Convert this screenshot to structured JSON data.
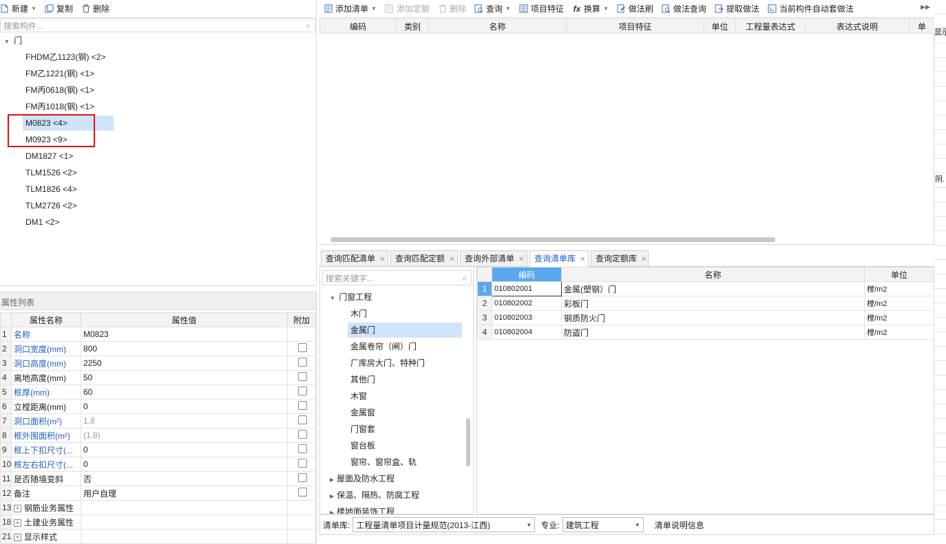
{
  "left_toolbar": {
    "new_label": "新建",
    "copy_label": "复制",
    "delete_label": "删除"
  },
  "component_search": {
    "placeholder": "搜索构件..."
  },
  "component_tree": {
    "root_label": "门",
    "items": [
      {
        "label": "FHDM乙1123(钢) <2>"
      },
      {
        "label": "FM乙1221(钢) <1>"
      },
      {
        "label": "FM丙0618(钢) <1>"
      },
      {
        "label": "FM丙1018(钢) <1>"
      },
      {
        "label": "M0823 <4>",
        "selected": true
      },
      {
        "label": "M0923 <9>"
      },
      {
        "label": "DM1827 <1>"
      },
      {
        "label": "TLM1526 <2>"
      },
      {
        "label": "TLM1826 <4>"
      },
      {
        "label": "TLM2726 <2>"
      },
      {
        "label": "DM1 <2>"
      }
    ]
  },
  "highlight_color": "#e01010",
  "properties": {
    "title": "属性列表",
    "headers": {
      "name": "属性名称",
      "value": "属性值",
      "extra": "附加"
    },
    "rows": [
      {
        "num": "1",
        "name": "名称",
        "value": "M0823",
        "blue": true,
        "check": false
      },
      {
        "num": "2",
        "name": "洞口宽度(mm)",
        "value": "800",
        "blue": true,
        "check": true
      },
      {
        "num": "3",
        "name": "洞口高度(mm)",
        "value": "2250",
        "blue": true,
        "check": true
      },
      {
        "num": "4",
        "name": "离地高度(mm)",
        "value": "50",
        "blue": false,
        "check": true
      },
      {
        "num": "5",
        "name": "框厚(mm)",
        "value": "60",
        "blue": true,
        "check": true
      },
      {
        "num": "6",
        "name": "立樘距离(mm)",
        "value": "0",
        "blue": false,
        "check": true
      },
      {
        "num": "7",
        "name": "洞口面积(m²)",
        "value": "1.8",
        "blue": true,
        "check": true,
        "gray": true
      },
      {
        "num": "8",
        "name": "框外围面积(m²)",
        "value": "(1.8)",
        "blue": true,
        "check": true,
        "gray": true
      },
      {
        "num": "9",
        "name": "框上下扣尺寸(...",
        "value": "0",
        "blue": true,
        "check": true
      },
      {
        "num": "10",
        "name": "框左右扣尺寸(...",
        "value": "0",
        "blue": true,
        "check": true
      },
      {
        "num": "11",
        "name": "是否随墙变斜",
        "value": "否",
        "blue": false,
        "check": true
      },
      {
        "num": "12",
        "name": "备注",
        "value": "用户自理",
        "blue": false,
        "check": true
      },
      {
        "num": "13",
        "name": "钢筋业务属性",
        "value": "",
        "expand": true
      },
      {
        "num": "18",
        "name": "土建业务属性",
        "value": "",
        "expand": true
      },
      {
        "num": "21",
        "name": "显示样式",
        "value": "",
        "expand": true
      }
    ]
  },
  "right_toolbar": {
    "add_list": "添加清单",
    "add_quota": "添加定额",
    "delete": "删除",
    "query": "查询",
    "item_features": "项目特征",
    "convert": "换算",
    "method_brush": "做法刷",
    "method_query": "做法查询",
    "extract_method": "提取做法",
    "auto_method": "当前构件自动套做法"
  },
  "top_grid": {
    "headers": [
      "编码",
      "类别",
      "名称",
      "项目特征",
      "单位",
      "工程量表达式",
      "表达式说明",
      "单"
    ]
  },
  "far_right": {
    "text1": "显示",
    "text2": "阴."
  },
  "bottom_tabs": [
    {
      "label": "查询匹配清单",
      "active": false
    },
    {
      "label": "查询匹配定额",
      "active": false
    },
    {
      "label": "查询外部清单",
      "active": false
    },
    {
      "label": "查询清单库",
      "active": true
    },
    {
      "label": "查询定额库",
      "active": false
    }
  ],
  "keyword_search": {
    "placeholder": "搜索关键字..."
  },
  "category_tree": {
    "group_label": "门窗工程",
    "items": [
      {
        "label": "木门"
      },
      {
        "label": "金属门",
        "selected": true
      },
      {
        "label": "金属卷帘（闸）门"
      },
      {
        "label": "厂库房大门、特种门"
      },
      {
        "label": "其他门"
      },
      {
        "label": "木窗"
      },
      {
        "label": "金属窗"
      },
      {
        "label": "门窗套"
      },
      {
        "label": "窗台板"
      },
      {
        "label": "窗帘、窗帘盒、轨"
      }
    ],
    "collapsed_groups": [
      {
        "label": "屋面及防水工程"
      },
      {
        "label": "保温、隔热、防腐工程"
      },
      {
        "label": "楼地面装饰工程"
      }
    ]
  },
  "result_grid": {
    "headers": {
      "code": "编码",
      "name": "名称",
      "unit": "单位"
    },
    "rows": [
      {
        "num": "1",
        "code": "010802001",
        "name": "金属(塑钢）门",
        "unit": "樘/m2"
      },
      {
        "num": "2",
        "code": "010802002",
        "name": "彩板门",
        "unit": "樘/m2"
      },
      {
        "num": "3",
        "code": "010802003",
        "name": "钢质防火门",
        "unit": "樘/m2"
      },
      {
        "num": "4",
        "code": "010802004",
        "name": "防盗门",
        "unit": "樘/m2"
      }
    ]
  },
  "footer": {
    "lib_label": "清单库:",
    "lib_value": "工程量清单项目计量规范(2013-江西)",
    "major_label": "专业:",
    "major_value": "建筑工程",
    "info_label": "清单说明信息"
  }
}
